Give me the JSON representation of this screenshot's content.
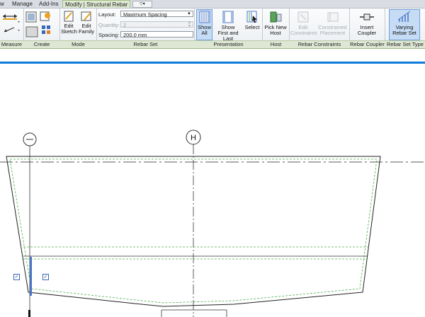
{
  "tabs": [
    {
      "label": "w"
    },
    {
      "label": "Manage"
    },
    {
      "label": "Add-Ins"
    },
    {
      "label": "Modify | Structural Rebar",
      "active": true
    }
  ],
  "panels": {
    "measure": "Measure",
    "create": "Create",
    "mode": "Mode",
    "rebar_set": "Rebar Set",
    "presentation": "Presentation",
    "host": "Host",
    "rebar_constraints": "Rebar Constraints",
    "rebar_coupler": "Rebar Coupler",
    "rebar_set_type": "Rebar Set Type"
  },
  "mode": {
    "edit_sketch": [
      "Edit",
      "Sketch"
    ],
    "edit_family": [
      "Edit",
      "Family"
    ]
  },
  "rebar_set": {
    "layout_label": "Layout:",
    "layout_value": "Maximum Spacing",
    "quantity_label": "Quantity:",
    "quantity_value": "2",
    "spacing_label": "Spacing:",
    "spacing_value": "200.0 mm"
  },
  "presentation": {
    "show_all": [
      "Show",
      "All"
    ],
    "show_first_last": [
      "Show",
      "First and Last"
    ],
    "select": "Select"
  },
  "host": {
    "pick_new_host": [
      "Pick New",
      "Host"
    ]
  },
  "constraints": {
    "edit_constraints": [
      "Edit",
      "Constraints"
    ],
    "constrained_placement": [
      "Constrained",
      "Placement"
    ]
  },
  "coupler": {
    "insert_coupler": [
      "Insert",
      "Coupler"
    ]
  },
  "set_type": {
    "varying_rebar_set": [
      "Varying",
      "Rebar Set"
    ]
  },
  "grid": {
    "grid_h": "H"
  },
  "colors": {
    "accent": "#0f7ad8",
    "rebar": "#4a74c6",
    "panel_bar": "#dde7d3",
    "dashed_rebar": "#4caf50"
  }
}
